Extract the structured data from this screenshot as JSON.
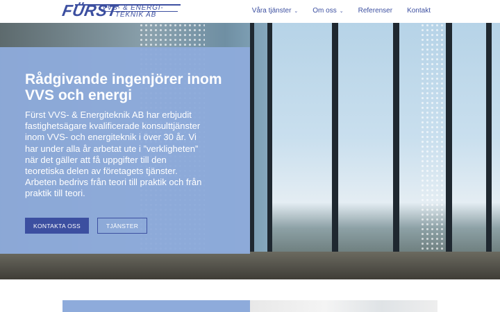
{
  "header": {
    "logo": {
      "firm": "FÜRST",
      "line1": "VVS- & ENERGI-",
      "line2": "TEKNIK AB"
    },
    "nav": [
      {
        "label": "Våra tjänster",
        "dropdown": true
      },
      {
        "label": "Om oss",
        "dropdown": true
      },
      {
        "label": "Referenser",
        "dropdown": false
      },
      {
        "label": "Kontakt",
        "dropdown": false
      }
    ]
  },
  "hero": {
    "title": "Rådgivande ingenjörer inom VVS och energi",
    "text": "Fürst VVS- & Energiteknik AB har erbjudit fastighetsägare kvalificerade konsulttjänster inom VVS- och energiteknik i över 30 år. Vi har under alla år arbetat ute i ”verkligheten” när det gäller att få uppgifter till den teoretiska delen av företagets tjänster. Arbeten bedrivs från teori till praktik och från praktik till teori.",
    "primary_button": "KONTAKTA OSS",
    "secondary_button": "TJÄNSTER"
  },
  "colors": {
    "brand": "#3c4fa0",
    "overlay": "#8eabdb",
    "text_on_overlay": "#ffffff"
  },
  "icons": {
    "dropdown": "chevron-down-icon"
  }
}
